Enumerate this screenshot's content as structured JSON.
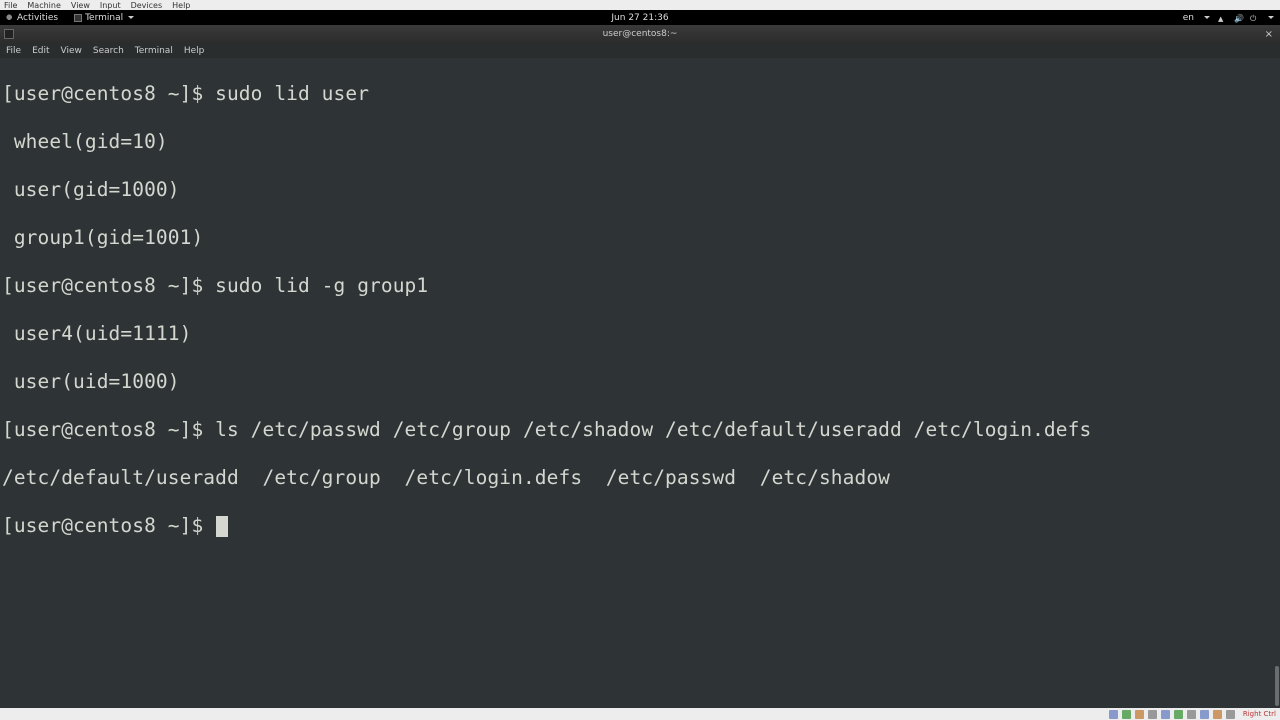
{
  "vbox_menu": {
    "items": [
      "File",
      "Machine",
      "View",
      "Input",
      "Devices",
      "Help"
    ]
  },
  "gnome": {
    "activities": "Activities",
    "app_name": "Terminal",
    "clock": "Jun 27  21:36",
    "lang": "en"
  },
  "terminal_window": {
    "title": "user@centos8:~",
    "close": "×"
  },
  "terminal_menu": {
    "items": [
      "File",
      "Edit",
      "View",
      "Search",
      "Terminal",
      "Help"
    ]
  },
  "prompt": "[user@centos8 ~]$ ",
  "session": {
    "lines": [
      "[user@centos8 ~]$ sudo lid user",
      " wheel(gid=10)",
      " user(gid=1000)",
      " group1(gid=1001)",
      "[user@centos8 ~]$ sudo lid -g group1",
      " user4(uid=1111)",
      " user(uid=1000)",
      "[user@centos8 ~]$ ls /etc/passwd /etc/group /etc/shadow /etc/default/useradd /etc/login.defs",
      "/etc/default/useradd  /etc/group  /etc/login.defs  /etc/passwd  /etc/shadow"
    ]
  },
  "vbox_status": {
    "host_key": "Right Ctrl"
  }
}
